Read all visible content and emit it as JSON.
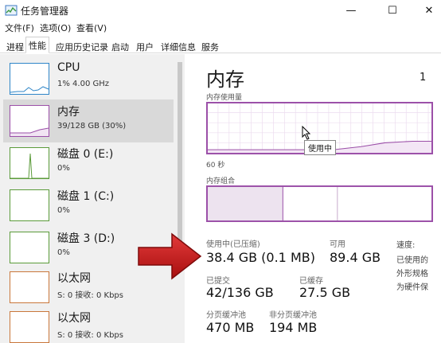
{
  "window": {
    "title": "任务管理器",
    "minimize": "—",
    "maximize": "☐",
    "close": "✕"
  },
  "menu": [
    "文件(F)",
    "选项(O)",
    "查看(V)"
  ],
  "tabs": [
    "进程",
    "性能",
    "应用历史记录",
    "启动",
    "用户",
    "详细信息",
    "服务"
  ],
  "active_tab": "性能",
  "sidebar": [
    {
      "name": "CPU",
      "detail": "1% 4.00 GHz",
      "color": "#2f86c8"
    },
    {
      "name": "内存",
      "detail": "39/128 GB (30%)",
      "color": "#9b4fa8"
    },
    {
      "name": "磁盘 0 (E:)",
      "detail": "0%",
      "color": "#5b9b3a"
    },
    {
      "name": "磁盘 1 (C:)",
      "detail": "0%",
      "color": "#5b9b3a"
    },
    {
      "name": "磁盘 3 (D:)",
      "detail": "0%",
      "color": "#5b9b3a"
    },
    {
      "name": "以太网",
      "detail": "S: 0 接收: 0 Kbps",
      "color": "#c9773b"
    },
    {
      "name": "以太网",
      "detail": "S: 0 接收: 0 Kbps",
      "color": "#c9773b"
    }
  ],
  "memory": {
    "title": "内存",
    "total": "1",
    "usage_label": "内存使用量",
    "time_label": "60 秒",
    "composition_label": "内存组合",
    "tooltip": "使用中",
    "in_use_label": "使用中(已压缩)",
    "in_use_value": "38.4 GB (0.1 MB)",
    "available_label": "可用",
    "available_value": "89.4 GB",
    "committed_label": "已提交",
    "committed_value": "42/136 GB",
    "cached_label": "已缓存",
    "cached_value": "27.5 GB",
    "paged_label": "分页缓冲池",
    "paged_value": "470 MB",
    "nonpaged_label": "非分页缓冲池",
    "nonpaged_value": "194 MB",
    "right_labels": [
      "速度:",
      "已使用的",
      "外形规格",
      "为硬件保"
    ]
  }
}
